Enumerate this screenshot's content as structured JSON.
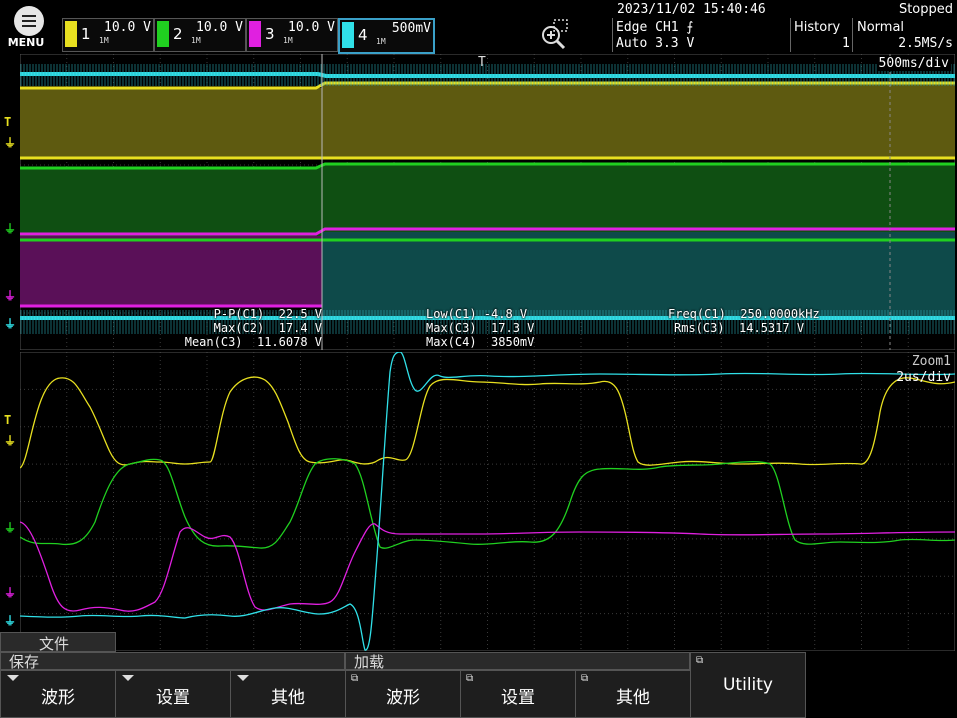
{
  "header": {
    "menu_label": "MENU",
    "channels": [
      {
        "num": "1",
        "volt": "10.0 V",
        "color": "#e8e020",
        "coupling": "1M"
      },
      {
        "num": "2",
        "volt": "10.0 V",
        "color": "#20d020",
        "coupling": "1M"
      },
      {
        "num": "3",
        "volt": "10.0 V",
        "color": "#e020e0",
        "coupling": "1M"
      },
      {
        "num": "4",
        "volt": "500mV",
        "color": "#30e0e8",
        "coupling": "1M"
      }
    ],
    "zoom_icon": "zoom-icon",
    "datetime": "2023/11/02 15:40:46",
    "status": "Stopped",
    "trigger_line1": "Edge CH1 ⨍",
    "trigger_line2": "Auto 3.3 V",
    "history_label": "History",
    "history_value": "1",
    "acq_mode": "Normal",
    "sample_rate": "2.5MS/s"
  },
  "main_display": {
    "time_div": "500ms/div",
    "measurements": [
      [
        "P-P(C1)  22.5 V",
        "Low(C1) -4.8 V",
        "Freq(C1)  250.0000kHz"
      ],
      [
        "Max(C2)  17.4 V",
        "Max(C3)  17.3 V",
        "Rms(C3)  14.5317 V"
      ],
      [
        "Mean(C3)  11.6078 V",
        "Max(C4)  3850mV",
        ""
      ]
    ]
  },
  "zoom_display": {
    "name": "Zoom1",
    "time_div": "2us/div"
  },
  "bottom_menu": {
    "tab_file": "文件",
    "tab_save": "保存",
    "tab_load": "加载",
    "softkeys": [
      {
        "label": "波形",
        "kind": "dropdown"
      },
      {
        "label": "设置",
        "kind": "dropdown"
      },
      {
        "label": "其他",
        "kind": "dropdown"
      },
      {
        "label": "波形",
        "kind": "external"
      },
      {
        "label": "设置",
        "kind": "external"
      },
      {
        "label": "其他",
        "kind": "external"
      },
      {
        "label": "Utility",
        "kind": "external"
      }
    ]
  },
  "colors": {
    "ch1": "#e8e020",
    "ch2": "#20d020",
    "ch3": "#e020e0",
    "ch4": "#30e0e8",
    "grid": "#3a3a3a"
  }
}
